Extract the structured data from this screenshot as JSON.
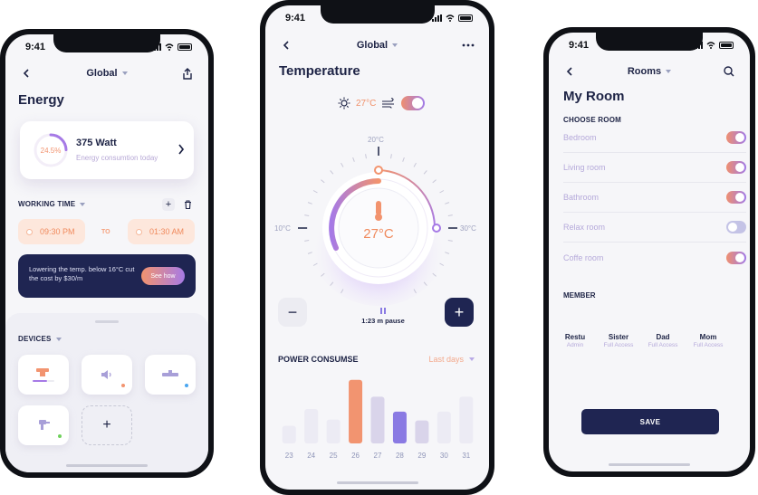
{
  "status": {
    "time": "9:41"
  },
  "colors": {
    "accent_orange": "#f29470",
    "accent_purple": "#8a7ae3",
    "navy": "#1f2552",
    "bar_muted": "#ecebf4",
    "bar_lavender": "#d9d4ea"
  },
  "energy_screen": {
    "nav_title": "Global",
    "title": "Energy",
    "card": {
      "percent": "24.5%",
      "percent_value": 0.245,
      "watt": "375 Watt",
      "subtitle": "Energy consumtion today"
    },
    "working_time": {
      "label": "WORKING TIME",
      "from": "09:30 PM",
      "to_label": "TO",
      "to": "01:30 AM"
    },
    "promo": {
      "text": "Lowering the temp. below 16°C cut the cost by $30/m",
      "button": "See how"
    },
    "devices": {
      "label": "DEVICES",
      "add_symbol": "+"
    }
  },
  "temperature_screen": {
    "nav_title": "Global",
    "title": "Temperature",
    "current_temp": "27°C",
    "dial": {
      "min_label": "10°C",
      "mid_label": "20°C",
      "max_label": "30°C",
      "value_label": "27°C",
      "min": 10,
      "max": 30,
      "value": 27
    },
    "pause": "1:23 m pause",
    "minus_symbol": "−",
    "plus_symbol": "+",
    "power_label": "POWER CONSUMSE",
    "range_label": "Last days"
  },
  "chart_data": {
    "type": "bar",
    "categories": [
      "23",
      "24",
      "25",
      "26",
      "27",
      "28",
      "29",
      "30",
      "31"
    ],
    "values": [
      20,
      39,
      27,
      72,
      53,
      36,
      26,
      36,
      53
    ],
    "ylim": [
      0,
      80
    ]
  },
  "rooms_screen": {
    "nav_title": "Rooms",
    "title": "My Room",
    "choose_label": "CHOOSE ROOM",
    "rooms": [
      {
        "name": "Bedroom",
        "on": true
      },
      {
        "name": "Living room",
        "on": true
      },
      {
        "name": "Bathroom",
        "on": true
      },
      {
        "name": "Relax room",
        "on": false
      },
      {
        "name": "Coffe room",
        "on": true
      }
    ],
    "member_label": "MEMBER",
    "members": [
      {
        "name": "Restu",
        "role": "Admin"
      },
      {
        "name": "Sister",
        "role": "Full Access"
      },
      {
        "name": "Dad",
        "role": "Full Access"
      },
      {
        "name": "Mom",
        "role": "Full Access"
      }
    ],
    "save": "SAVE"
  }
}
